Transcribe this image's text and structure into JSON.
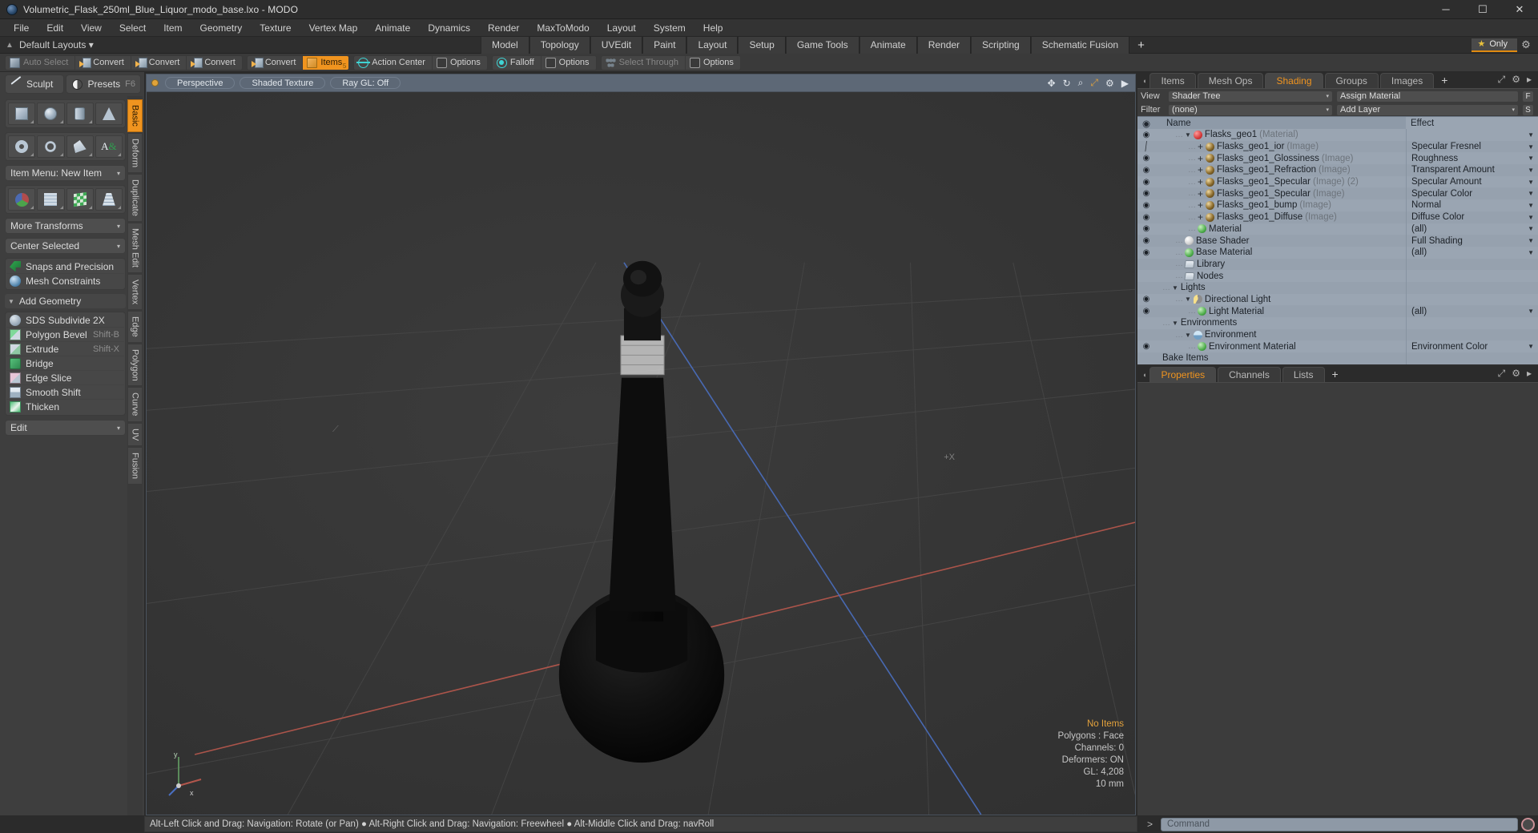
{
  "window": {
    "title": "Volumetric_Flask_250ml_Blue_Liquor_modo_base.lxo - MODO",
    "app_icon": "modo-icon",
    "minimize": "─",
    "maximize": "☐",
    "close": "✕"
  },
  "menu": {
    "items": [
      "File",
      "Edit",
      "View",
      "Select",
      "Item",
      "Geometry",
      "Texture",
      "Vertex Map",
      "Animate",
      "Dynamics",
      "Render",
      "MaxToModo",
      "Layout",
      "System",
      "Help"
    ]
  },
  "layout_bar": {
    "preset_label": "Default Layouts",
    "caret": "▾",
    "up_arrow": "▲",
    "tabs": [
      "Model",
      "Topology",
      "UVEdit",
      "Paint",
      "Layout",
      "Setup",
      "Game Tools",
      "Animate",
      "Render",
      "Scripting",
      "Schematic Fusion"
    ],
    "add_tab": "+",
    "only_label": "Only",
    "star": "★",
    "gear": "⚙"
  },
  "mode_bar": {
    "groups": [
      {
        "buttons": [
          {
            "label": "Auto Select",
            "icon": "cube-gray-icon",
            "state": "disabled"
          },
          {
            "label": "Convert",
            "icon": "convert-vertex-icon",
            "state": "normal"
          },
          {
            "label": "Convert",
            "icon": "convert-edge-icon",
            "state": "normal"
          },
          {
            "label": "Convert",
            "icon": "convert-polygon-icon",
            "state": "normal"
          }
        ]
      },
      {
        "buttons": [
          {
            "label": "Convert",
            "icon": "convert-item-icon",
            "state": "normal"
          },
          {
            "label": "Items",
            "icon": "items-cube-icon",
            "state": "active",
            "badge": "5"
          }
        ]
      },
      {
        "buttons": [
          {
            "label": "Action Center",
            "icon": "action-center-icon",
            "state": "normal"
          },
          {
            "label": "Options",
            "icon": "options-square-icon",
            "state": "normal"
          }
        ]
      },
      {
        "buttons": [
          {
            "label": "Falloff",
            "icon": "falloff-icon",
            "state": "normal"
          },
          {
            "label": "Options",
            "icon": "options-square-icon",
            "state": "normal"
          }
        ]
      },
      {
        "buttons": [
          {
            "label": "Select Through",
            "icon": "select-through-icon",
            "state": "disabled"
          },
          {
            "label": "Options",
            "icon": "options-square-icon",
            "state": "normal"
          }
        ]
      }
    ]
  },
  "left_panel": {
    "top_buttons": [
      {
        "label": "Sculpt",
        "icon": "pencil-icon",
        "shortcut": ""
      },
      {
        "label": "Presets",
        "icon": "sphere-half-icon",
        "shortcut": "F6"
      }
    ],
    "primitives_row1": [
      {
        "name": "cube-primitive",
        "icon": "cube-shape"
      },
      {
        "name": "sphere-primitive",
        "icon": "sphere-shape"
      },
      {
        "name": "cylinder-primitive",
        "icon": "cylinder-shape"
      },
      {
        "name": "cone-primitive",
        "icon": "cone-shape"
      }
    ],
    "primitives_row2": [
      {
        "name": "torus-primitive",
        "icon": "torus-shape"
      },
      {
        "name": "spiral-primitive",
        "icon": "spiral-shape"
      },
      {
        "name": "polygon-primitive",
        "icon": "polygon-shape"
      },
      {
        "name": "text-primitive",
        "icon": "text-shape"
      }
    ],
    "item_menu": {
      "label": "Item Menu: New Item",
      "caret": "▾"
    },
    "transforms_row": [
      {
        "name": "transform-axis-tool",
        "icon": "axis-shape"
      },
      {
        "name": "bend-tool",
        "icon": "grid-shape-1"
      },
      {
        "name": "shear-tool",
        "icon": "grid-shape-2"
      },
      {
        "name": "taper-tool",
        "icon": "grid-shape-3"
      }
    ],
    "more_transforms": {
      "label": "More Transforms",
      "caret": "▾"
    },
    "center_selected": {
      "label": "Center Selected",
      "caret": "▾"
    },
    "snaps": [
      {
        "label": "Snaps and Precision",
        "icon": "snap-icon"
      },
      {
        "label": "Mesh Constraints",
        "icon": "mesh-constraint-icon"
      }
    ],
    "add_geometry_header": {
      "label": "Add Geometry",
      "tri": "▼"
    },
    "geometry_tools": [
      {
        "label": "SDS Subdivide 2X",
        "shortcut": "",
        "icon": "sds-icon"
      },
      {
        "label": "Polygon Bevel",
        "shortcut": "Shift-B",
        "icon": "bevel-icon"
      },
      {
        "label": "Extrude",
        "shortcut": "Shift-X",
        "icon": "extrude-icon"
      },
      {
        "label": "Bridge",
        "shortcut": "",
        "icon": "bridge-icon"
      },
      {
        "label": "Edge Slice",
        "shortcut": "",
        "icon": "edge-slice-icon"
      },
      {
        "label": "Smooth Shift",
        "shortcut": "",
        "icon": "smooth-shift-icon"
      },
      {
        "label": "Thicken",
        "shortcut": "",
        "icon": "thicken-icon"
      }
    ],
    "edit_dropdown": {
      "label": "Edit",
      "caret": "▾"
    },
    "vertical_tabs": [
      "Basic",
      "Deform",
      "Duplicate",
      "Mesh Edit",
      "Vertex",
      "Edge",
      "Polygon",
      "Curve",
      "UV",
      "Fusion"
    ],
    "active_vertical_tab": "Basic"
  },
  "viewport": {
    "pills": [
      "Perspective",
      "Shaded Texture",
      "Ray GL: Off"
    ],
    "tool_icons": [
      "move-icon",
      "rotate-icon",
      "zoom-icon",
      "fit-icon",
      "gear-icon",
      "play-icon"
    ],
    "plus_x_label": "+X",
    "axis_label_y": "y",
    "axis_label_x": "x",
    "info": {
      "no_items": "No Items",
      "polygons": "Polygons : Face",
      "channels": "Channels: 0",
      "deformers": "Deformers: ON",
      "gl": "GL: 4,208",
      "scale": "10 mm"
    }
  },
  "right_panel": {
    "tabs": [
      "Items",
      "Mesh Ops",
      "Shading",
      "Groups",
      "Images"
    ],
    "active_tab": "Shading",
    "add_tab": "+",
    "controls": {
      "view_label": "View",
      "view_value": "Shader Tree",
      "assign_value": "Assign Material",
      "assign_button": "F",
      "filter_label": "Filter",
      "filter_value": "(none)",
      "add_layer_value": "Add Layer",
      "add_layer_button": "S",
      "caret": "▾"
    },
    "tree_header": {
      "eye": "◉",
      "name": "Name",
      "effect": "Effect"
    },
    "tree_rows": [
      {
        "eye": "eye-icon",
        "indent": 1,
        "tri": "▼",
        "icon": "ball-red",
        "name": "Flasks_geo1",
        "suffix": "(Material)",
        "effect": "",
        "has_caret": true
      },
      {
        "eye": "brush-icon",
        "indent": 2,
        "plus": "+",
        "icon": "ball-image",
        "name": "Flasks_geo1_ior",
        "suffix": "(Image)",
        "effect": "Specular Fresnel",
        "has_caret": true
      },
      {
        "eye": "eye-icon",
        "indent": 2,
        "plus": "+",
        "icon": "ball-image",
        "name": "Flasks_geo1_Glossiness",
        "suffix": "(Image)",
        "effect": "Roughness",
        "has_caret": true
      },
      {
        "eye": "eye-icon",
        "indent": 2,
        "plus": "+",
        "icon": "ball-image",
        "name": "Flasks_geo1_Refraction",
        "suffix": "(Image)",
        "effect": "Transparent Amount",
        "has_caret": true
      },
      {
        "eye": "eye-icon",
        "indent": 2,
        "plus": "+",
        "icon": "ball-image",
        "name": "Flasks_geo1_Specular",
        "suffix": "(Image) (2)",
        "effect": "Specular Amount",
        "has_caret": true
      },
      {
        "eye": "eye-icon",
        "indent": 2,
        "plus": "+",
        "icon": "ball-image",
        "name": "Flasks_geo1_Specular",
        "suffix": "(Image)",
        "effect": "Specular Color",
        "has_caret": true
      },
      {
        "eye": "eye-icon",
        "indent": 2,
        "plus": "+",
        "icon": "ball-image",
        "name": "Flasks_geo1_bump",
        "suffix": "(Image)",
        "effect": "Normal",
        "has_caret": true
      },
      {
        "eye": "eye-icon",
        "indent": 2,
        "plus": "+",
        "icon": "ball-image",
        "name": "Flasks_geo1_Diffuse",
        "suffix": "(Image)",
        "effect": "Diffuse Color",
        "has_caret": true
      },
      {
        "eye": "eye-icon",
        "indent": 2,
        "plus": "",
        "icon": "ball-green",
        "name": "Material",
        "suffix": "",
        "effect": "(all)",
        "has_caret": true
      },
      {
        "eye": "eye-icon",
        "indent": 1,
        "plus": "",
        "icon": "ball-white",
        "name": "Base Shader",
        "suffix": "",
        "effect": "Full Shading",
        "has_caret": true
      },
      {
        "eye": "eye-icon",
        "indent": 1,
        "plus": "",
        "icon": "ball-green",
        "name": "Base Material",
        "suffix": "",
        "effect": "(all)",
        "has_caret": true
      },
      {
        "eye": "",
        "indent": 1,
        "plus": "",
        "icon": "folder",
        "name": "Library",
        "suffix": "",
        "effect": "",
        "has_caret": false
      },
      {
        "eye": "",
        "indent": 1,
        "plus": "",
        "icon": "folder",
        "name": "Nodes",
        "suffix": "",
        "effect": "",
        "has_caret": false
      },
      {
        "eye": "",
        "indent": 0,
        "tri": "▼",
        "icon": "",
        "name": "Lights",
        "suffix": "",
        "effect": "",
        "has_caret": false
      },
      {
        "eye": "eye-icon",
        "indent": 1,
        "tri": "▼",
        "icon": "ball-light",
        "name": "Directional Light",
        "suffix": "",
        "effect": "",
        "has_caret": false
      },
      {
        "eye": "eye-icon",
        "indent": 2,
        "plus": "",
        "icon": "ball-green",
        "name": "Light Material",
        "suffix": "",
        "effect": "(all)",
        "has_caret": true
      },
      {
        "eye": "",
        "indent": 0,
        "tri": "▼",
        "icon": "",
        "name": "Environments",
        "suffix": "",
        "effect": "",
        "has_caret": false
      },
      {
        "eye": "",
        "indent": 1,
        "tri": "▼",
        "icon": "ball-env",
        "name": "Environment",
        "suffix": "",
        "effect": "",
        "has_caret": false
      },
      {
        "eye": "eye-icon",
        "indent": 2,
        "plus": "",
        "icon": "ball-green",
        "name": "Environment Material",
        "suffix": "",
        "effect": "Environment Color",
        "has_caret": true
      },
      {
        "eye": "",
        "indent": 0,
        "plus": "",
        "icon": "",
        "name": "Bake Items",
        "suffix": "",
        "effect": "",
        "has_caret": false
      }
    ],
    "properties_tabs": [
      "Properties",
      "Channels",
      "Lists"
    ],
    "properties_active": "Properties",
    "properties_add": "+"
  },
  "status_bar": {
    "hint": "Alt-Left Click and Drag: Navigation: Rotate (or Pan) ● Alt-Right Click and Drag: Navigation: Freewheel ● Alt-Middle Click and Drag: navRoll",
    "command_prompt": ">",
    "command_placeholder": "Command",
    "record_icon": "record-icon"
  },
  "colors": {
    "accent": "#f0941f",
    "tree_bg": "#9aa5b2",
    "panel_bg": "#3e3e3e",
    "viewport_bg": "#333333",
    "axis_x": "#c0564a",
    "axis_z": "#4a6fc0"
  }
}
